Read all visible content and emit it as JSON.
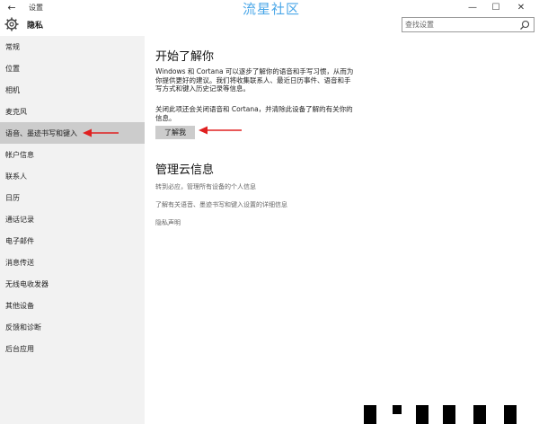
{
  "window": {
    "title": "设置",
    "back_glyph": "←",
    "minimize_glyph": "—",
    "maximize_glyph": "☐",
    "close_glyph": "✕",
    "watermark": "流星社区"
  },
  "header": {
    "page_title": "隐私",
    "search_placeholder": "查找设置"
  },
  "sidebar": {
    "items": [
      {
        "label": "常规"
      },
      {
        "label": "位置"
      },
      {
        "label": "相机"
      },
      {
        "label": "麦克风"
      },
      {
        "label": "语音、墨迹书写和键入",
        "selected": true
      },
      {
        "label": "帐户信息"
      },
      {
        "label": "联系人"
      },
      {
        "label": "日历"
      },
      {
        "label": "通话记录"
      },
      {
        "label": "电子邮件"
      },
      {
        "label": "消息传送"
      },
      {
        "label": "无线电收发器"
      },
      {
        "label": "其他设备"
      },
      {
        "label": "反馈和诊断"
      },
      {
        "label": "后台应用"
      }
    ]
  },
  "main": {
    "section1": {
      "title": "开始了解你",
      "description": "Windows 和 Cortana 可以逐步了解你的语音和手写习惯，从而为你提供更好的建议。我们将收集联系人、最近日历事件、语音和手写方式和键入历史记录等信息。",
      "note": "关闭此项还会关闭语音和 Cortana，并清除此设备了解的有关你的信息。",
      "button_label": "了解我"
    },
    "section2": {
      "title": "管理云信息",
      "links": [
        "转到必应，管理所有设备的个人信息",
        "了解有关语音、墨迹书写和键入设置的详细信息",
        "隐私声明"
      ]
    }
  },
  "colors": {
    "sidebar_bg": "#f2f2f2",
    "selected_bg": "#cccccc",
    "annotation_arrow": "#e02020",
    "watermark": "#4aa7e8"
  }
}
